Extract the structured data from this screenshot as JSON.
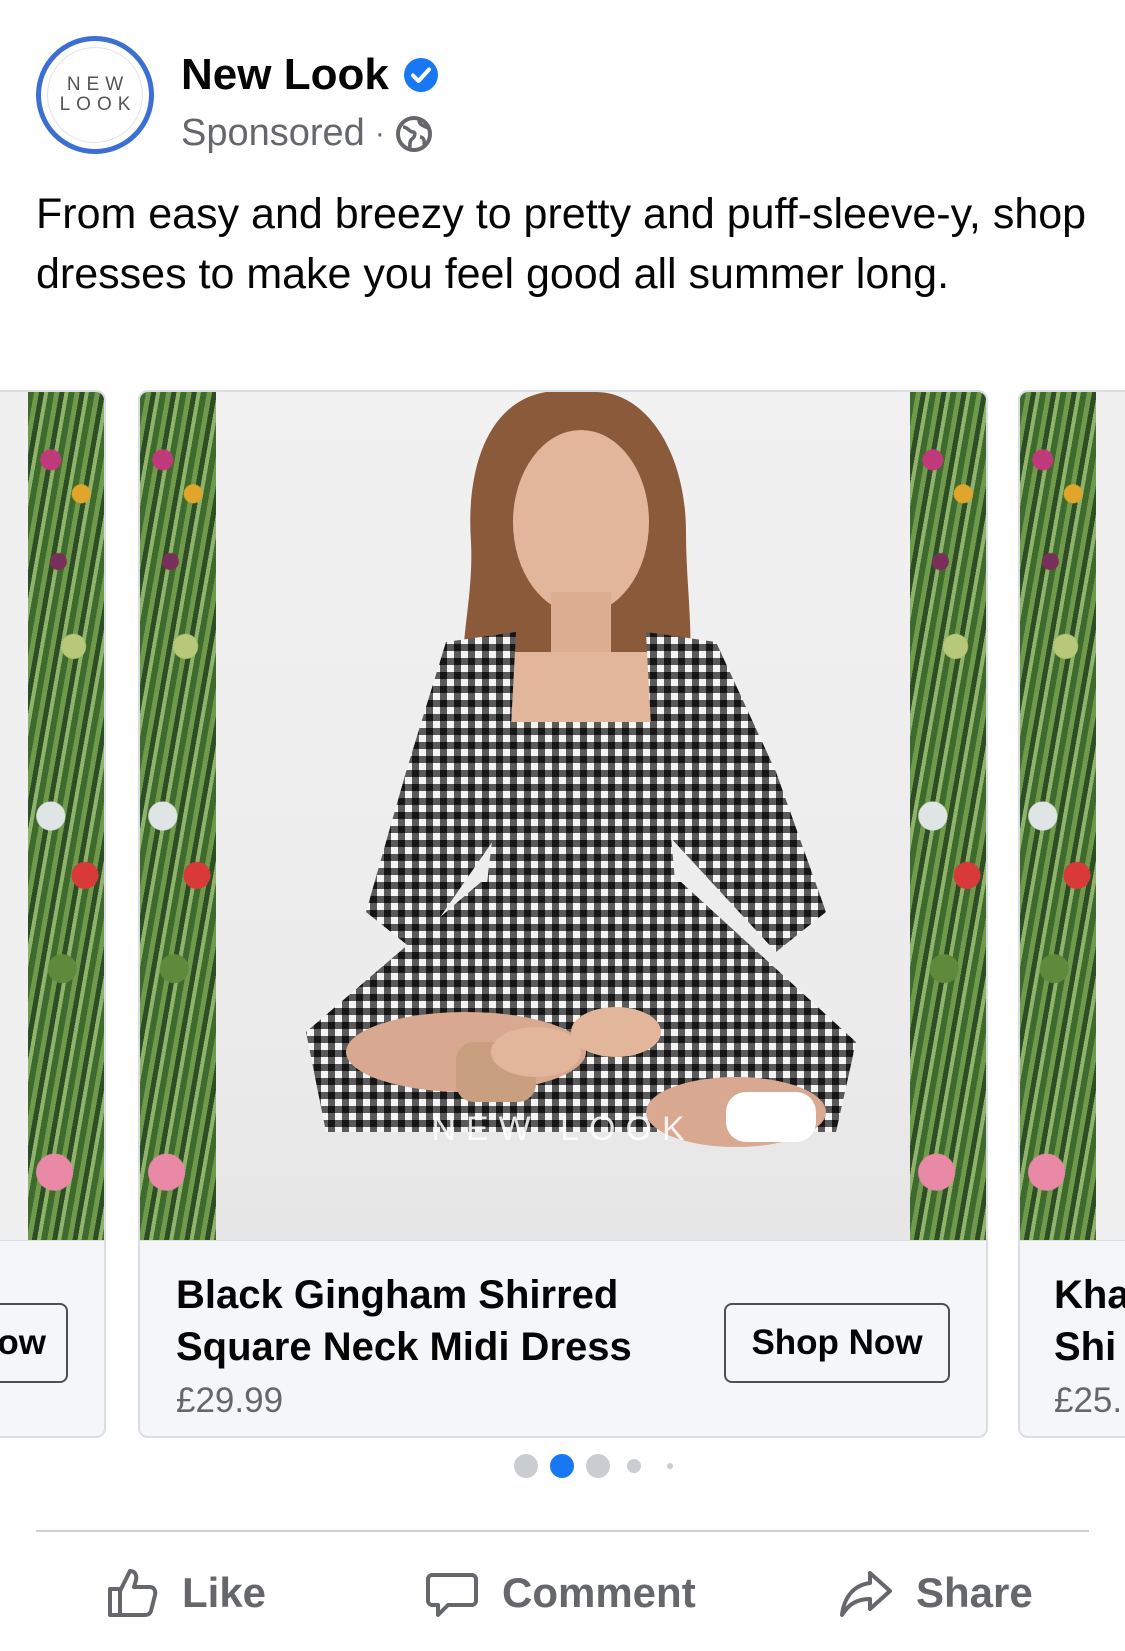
{
  "post": {
    "page_name": "New Look",
    "sponsored_label": "Sponsored",
    "separator": "·",
    "avatar_logo": [
      "NEW",
      "LOOK"
    ],
    "caption": "From easy and breezy to pretty and puff-sleeve-y, shop dresses to make you feel good all summer long."
  },
  "carousel": {
    "left_card": {
      "button_label_partial": "ow"
    },
    "main_card": {
      "product_name": "Black Gingham Shirred Square Neck Midi Dress",
      "price": "£29.99",
      "button_label": "Shop Now",
      "watermark": "NEW LOOK"
    },
    "right_card": {
      "product_name_partial": [
        "Kha",
        "Shi"
      ],
      "price_partial": "£25."
    },
    "pagination": {
      "count": 5,
      "active_index": 1
    }
  },
  "actions": {
    "like": "Like",
    "comment": "Comment",
    "share": "Share"
  },
  "colors": {
    "verified_blue": "#1877f2",
    "active_dot": "#1877f2",
    "inactive_dot": "#c9ccd1",
    "avatar_ring": "#3b6fd4"
  },
  "icons": [
    "verified-badge-icon",
    "globe-icon",
    "like-thumb-icon",
    "comment-bubble-icon",
    "share-arrow-icon"
  ]
}
